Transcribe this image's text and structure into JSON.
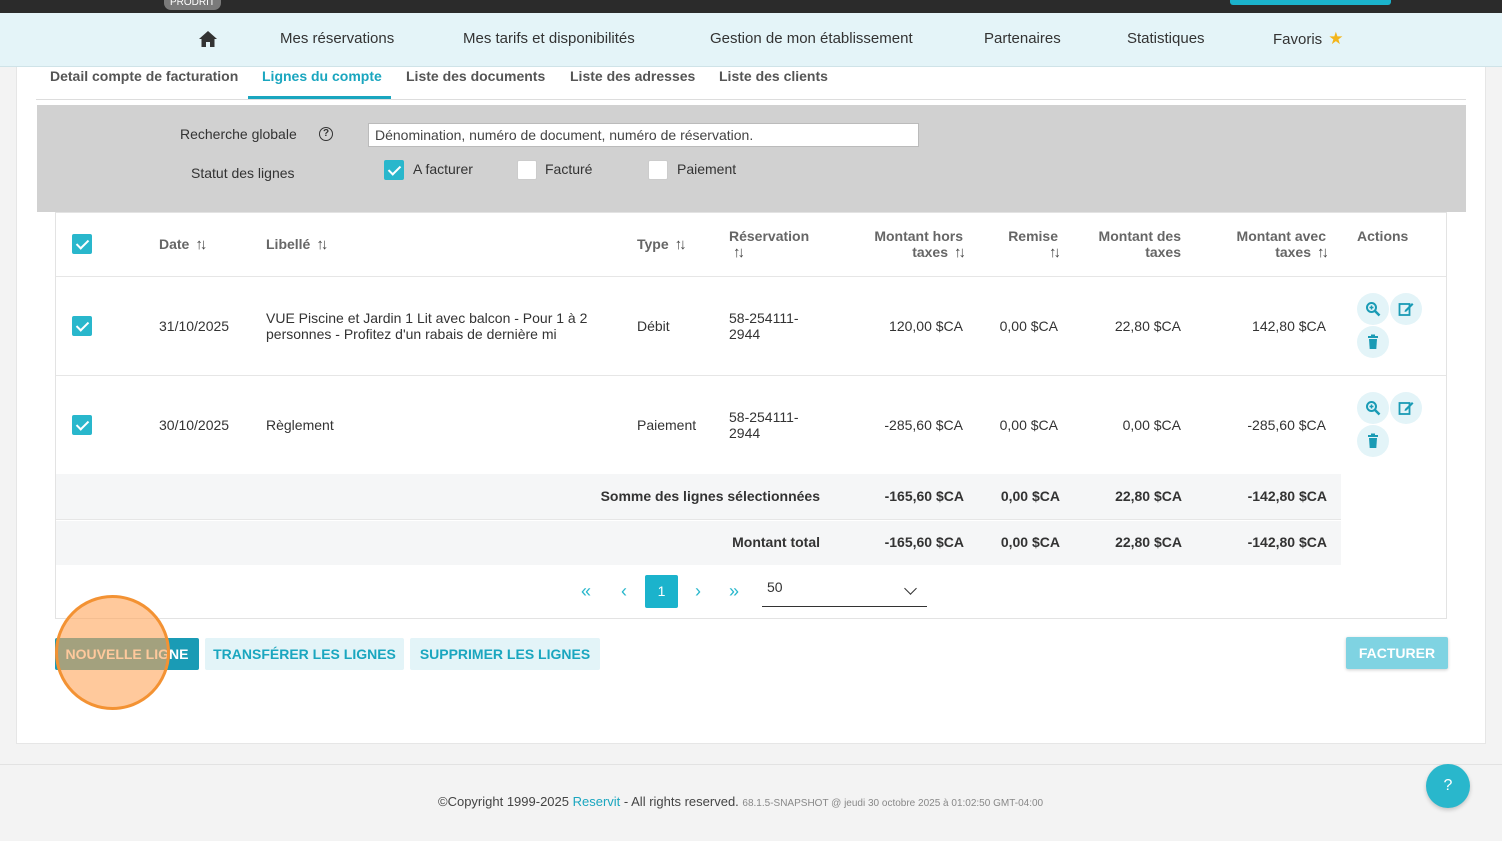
{
  "env_badge": "PRODRIT",
  "nav": {
    "items": [
      "Mes réservations",
      "Mes tarifs et disponibilités",
      "Gestion de mon établissement",
      "Partenaires",
      "Statistiques",
      "Favoris"
    ]
  },
  "tabs": [
    "Detail compte de facturation",
    "Lignes du compte",
    "Liste des documents",
    "Liste des adresses",
    "Liste des clients"
  ],
  "active_tab": "Lignes du compte",
  "filters": {
    "search_label": "Recherche globale",
    "search_placeholder": "Dénomination, numéro de document, numéro de réservation.",
    "status_label": "Statut des lignes",
    "statuses": [
      {
        "label": "A facturer",
        "checked": true
      },
      {
        "label": "Facturé",
        "checked": false
      },
      {
        "label": "Paiement",
        "checked": false
      }
    ]
  },
  "table": {
    "headers": {
      "date": "Date",
      "libelle": "Libellé",
      "type": "Type",
      "reservation": "Réservation",
      "ht_1": "Montant hors",
      "ht_2": "taxes",
      "remise": "Remise",
      "taxes_1": "Montant des",
      "taxes_2": "taxes",
      "ttc_1": "Montant avec",
      "ttc_2": "taxes",
      "actions": "Actions"
    },
    "rows": [
      {
        "checked": true,
        "date": "31/10/2025",
        "libelle_1": "VUE Piscine et Jardin 1 Lit avec balcon - Pour 1 à 2",
        "libelle_2": "personnes - Profitez d'un rabais de dernière mi",
        "type": "Débit",
        "reservation_1": "58-254111-",
        "reservation_2": "2944",
        "ht": "120,00 $CA",
        "remise": "0,00 $CA",
        "taxes": "22,80 $CA",
        "ttc": "142,80 $CA"
      },
      {
        "checked": true,
        "date": "30/10/2025",
        "libelle_1": "Règlement",
        "libelle_2": "",
        "type": "Paiement",
        "reservation_1": "58-254111-",
        "reservation_2": "2944",
        "ht": "-285,60 $CA",
        "remise": "0,00 $CA",
        "taxes": "0,00 $CA",
        "ttc": "-285,60 $CA"
      }
    ],
    "summary": [
      {
        "label": "Somme des lignes sélectionnées",
        "ht": "-165,60 $CA",
        "remise": "0,00 $CA",
        "taxes": "22,80 $CA",
        "ttc": "-142,80 $CA"
      },
      {
        "label": "Montant total",
        "ht": "-165,60 $CA",
        "remise": "0,00 $CA",
        "taxes": "22,80 $CA",
        "ttc": "-142,80 $CA"
      }
    ]
  },
  "pagination": {
    "first": "«",
    "prev": "‹",
    "current": "1",
    "next": "›",
    "last": "»",
    "page_size": "50"
  },
  "buttons": {
    "new_line": "NOUVELLE LIGNE",
    "transfer": "TRANSFÉRER LES LIGNES",
    "delete": "SUPPRIMER LES LIGNES",
    "invoice": "FACTURER"
  },
  "footer": {
    "copyright": "©Copyright 1999-2025 ",
    "brand": "Reservit",
    "rights": " - All rights reserved. ",
    "version": "68.1.5-SNAPSHOT @ jeudi 30 octobre 2025 à 01:02:50 GMT-04:00"
  },
  "help_fab": "?",
  "colors": {
    "accent": "#1bb3cc",
    "nav_bg": "#e4f4f8",
    "filter_bg": "#d1d1d1",
    "star": "#f3b51b",
    "highlight": "#f39233"
  }
}
